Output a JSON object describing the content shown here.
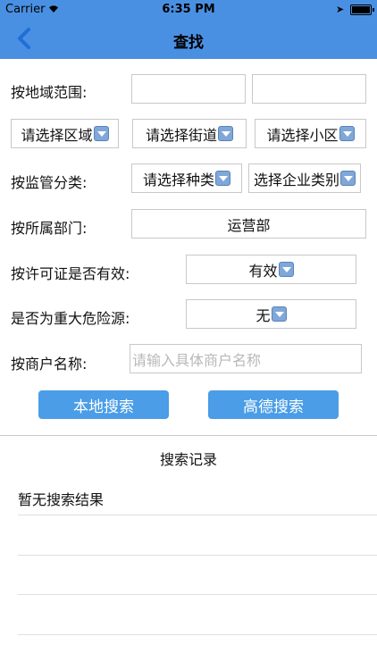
{
  "status": {
    "carrier": "Carrier",
    "time": "6:35 PM"
  },
  "nav": {
    "title": "查找"
  },
  "form": {
    "region_label": "按地域范围:",
    "district": "请选择区域",
    "street": "请选择街道",
    "community": "请选择小区",
    "regulation_label": "按监管分类:",
    "kind": "请选择种类",
    "enterprise_type": "选择企业类别",
    "department_label": "按所属部门:",
    "department_value": "运营部",
    "license_label": "按许可证是否有效:",
    "license_value": "有效",
    "hazard_label": "是否为重大危险源:",
    "hazard_value": "无",
    "merchant_label": "按商户名称:",
    "merchant_placeholder": "请输入具体商户名称"
  },
  "buttons": {
    "local_search": "本地搜索",
    "amap_search": "高德搜索"
  },
  "history": {
    "title": "搜索记录",
    "empty": "暂无搜索结果"
  }
}
